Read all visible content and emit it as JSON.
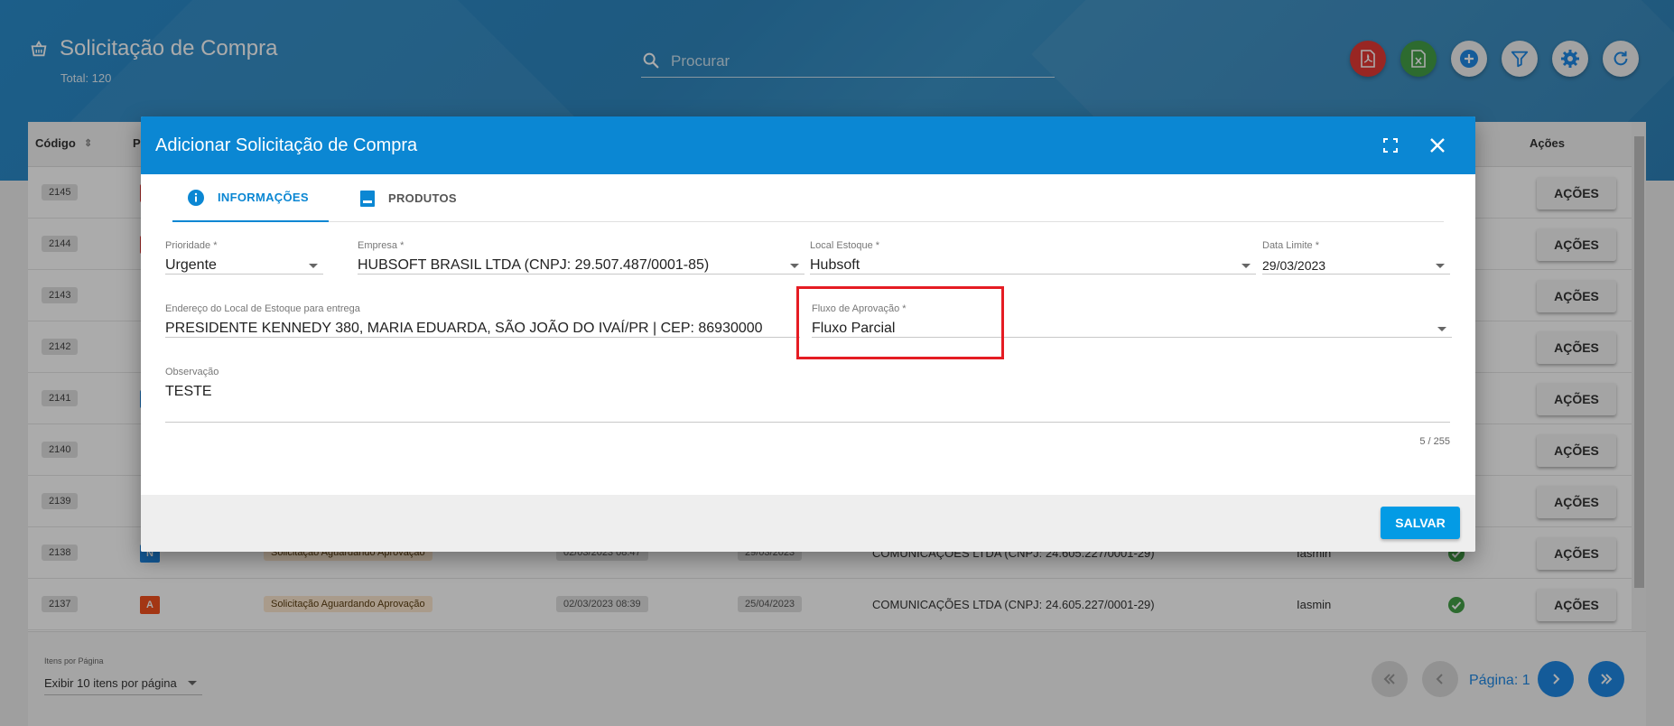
{
  "header": {
    "title": "Solicitação de Compra",
    "total": "Total: 120",
    "search_placeholder": "Procurar",
    "actions": [
      {
        "icon": "pdf-icon",
        "color": "#e53935"
      },
      {
        "icon": "excel-icon",
        "color": "#43a047"
      },
      {
        "icon": "plus-icon",
        "color": "#1e88e5"
      },
      {
        "icon": "filter-icon",
        "color": "#1e88e5"
      },
      {
        "icon": "gear-icon",
        "color": "#1e88e5"
      },
      {
        "icon": "refresh-icon",
        "color": "#1e88e5"
      }
    ]
  },
  "table": {
    "col_code": "Código",
    "col_p": "P",
    "col_actions": "Ações",
    "rows": [
      {
        "code": "2145"
      },
      {
        "code": "2144"
      },
      {
        "code": "2143"
      },
      {
        "code": "2142"
      },
      {
        "code": "2141"
      },
      {
        "code": "2140"
      },
      {
        "code": "2139"
      },
      {
        "code": "2138",
        "priority": "N",
        "priority_color": "#1e88e5",
        "status": "Solicitação Aguardando Aprovação",
        "created": "02/03/2023 08:47",
        "deadline": "29/03/2023",
        "company": "COMUNICAÇÕES LTDA (CNPJ: 24.605.227/0001-29)",
        "user": "Iasmin"
      },
      {
        "code": "2137",
        "priority": "A",
        "priority_color": "#f4511e",
        "status": "Solicitação Aguardando Aprovação",
        "created": "02/03/2023 08:39",
        "deadline": "25/04/2023",
        "company": "COMUNICAÇÕES LTDA (CNPJ: 24.605.227/0001-29)",
        "user": "Iasmin"
      }
    ],
    "action_label": "AÇÕES"
  },
  "footer": {
    "items_per_page_label": "Itens por Página",
    "items_per_page_value": "Exibir 10 itens por página",
    "page_label": "Página: 1"
  },
  "modal": {
    "title": "Adicionar Solicitação de Compra",
    "tabs": [
      {
        "label": "INFORMAÇÕES",
        "active": true
      },
      {
        "label": "PRODUTOS",
        "active": false
      }
    ],
    "fields": {
      "prioridade": {
        "label": "Prioridade *",
        "value": "Urgente"
      },
      "empresa": {
        "label": "Empresa *",
        "value": "HUBSOFT BRASIL LTDA (CNPJ: 29.507.487/0001-85)"
      },
      "local_estoque": {
        "label": "Local Estoque *",
        "value": "Hubsoft"
      },
      "data_limite": {
        "label": "Data Limite *",
        "value": "29/03/2023"
      },
      "endereco": {
        "label": "Endereço do Local de Estoque para entrega",
        "value": "PRESIDENTE KENNEDY 380, MARIA EDUARDA, SÃO JOÃO DO IVAÍ/PR | CEP: 86930000"
      },
      "fluxo": {
        "label": "Fluxo de Aprovação *",
        "value": "Fluxo Parcial"
      },
      "observacao": {
        "label": "Observação",
        "value": "TESTE"
      }
    },
    "counter": "5 / 255",
    "save_label": "SALVAR"
  }
}
